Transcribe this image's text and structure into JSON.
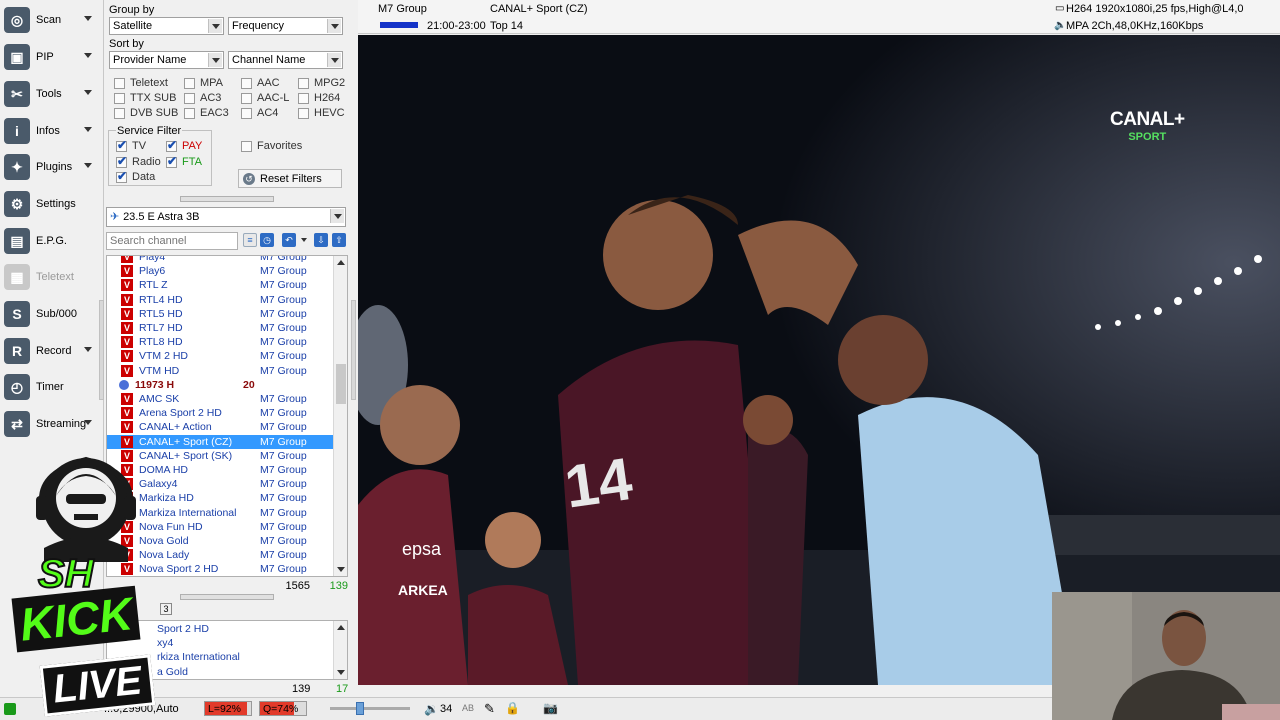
{
  "toolbar": {
    "items": [
      {
        "label": "Scan",
        "icon": "satellite-dish-icon",
        "arrow": true
      },
      {
        "label": "PIP",
        "icon": "pip-icon",
        "arrow": true
      },
      {
        "label": "Tools",
        "icon": "tools-icon",
        "arrow": true
      },
      {
        "label": "Infos",
        "icon": "info-icon",
        "arrow": true
      },
      {
        "label": "Plugins",
        "icon": "plugins-icon",
        "arrow": true
      },
      {
        "label": "Settings",
        "icon": "settings-gear-icon",
        "arrow": false
      },
      {
        "label": "E.P.G.",
        "icon": "epg-icon",
        "arrow": false
      },
      {
        "label": "Teletext",
        "icon": "teletext-icon",
        "arrow": false,
        "disabled": true
      },
      {
        "label": "Sub/000",
        "icon": "subtitle-icon",
        "arrow": false
      },
      {
        "label": "Record",
        "icon": "record-icon",
        "arrow": true
      },
      {
        "label": "Timer",
        "icon": "timer-icon",
        "arrow": false
      },
      {
        "label": "Streaming",
        "icon": "streaming-icon",
        "arrow": true
      }
    ]
  },
  "filters": {
    "group_by_label": "Group by",
    "group_by_1": "Satellite",
    "group_by_2": "Frequency",
    "sort_by_label": "Sort by",
    "sort_by_1": "Provider Name",
    "sort_by_2": "Channel Name",
    "checks": [
      [
        "Teletext",
        "MPA",
        "AAC",
        "MPG2"
      ],
      [
        "TTX SUB",
        "AC3",
        "AAC-L",
        "H264"
      ],
      [
        "DVB SUB",
        "EAC3",
        "AC4",
        "HEVC"
      ]
    ],
    "service_filter_label": "Service Filter",
    "service": {
      "tv": "TV",
      "pay": "PAY",
      "radio": "Radio",
      "fta": "FTA",
      "data": "Data"
    },
    "favorites_label": "Favorites",
    "reset_label": "Reset Filters"
  },
  "satellite": "23.5 E Astra 3B",
  "search": {
    "placeholder": "Search channel"
  },
  "channels": [
    {
      "name": "Play4",
      "provider": "M7 Group"
    },
    {
      "name": "Play6",
      "provider": "M7 Group"
    },
    {
      "name": "RTL Z",
      "provider": "M7 Group"
    },
    {
      "name": "RTL4 HD",
      "provider": "M7 Group"
    },
    {
      "name": "RTL5 HD",
      "provider": "M7 Group"
    },
    {
      "name": "RTL7 HD",
      "provider": "M7 Group"
    },
    {
      "name": "RTL8 HD",
      "provider": "M7 Group"
    },
    {
      "name": "VTM 2 HD",
      "provider": "M7 Group"
    },
    {
      "name": "VTM HD",
      "provider": "M7 Group"
    },
    {
      "group": true,
      "name": "11973 H",
      "count": "20"
    },
    {
      "name": "AMC SK",
      "provider": "M7 Group"
    },
    {
      "name": "Arena Sport 2 HD",
      "provider": "M7 Group"
    },
    {
      "name": "CANAL+ Action",
      "provider": "M7 Group"
    },
    {
      "name": "CANAL+ Sport (CZ)",
      "provider": "M7 Group",
      "selected": true
    },
    {
      "name": "CANAL+ Sport (SK)",
      "provider": "M7 Group"
    },
    {
      "name": "DOMA HD",
      "provider": "M7 Group"
    },
    {
      "name": "Galaxy4",
      "provider": "M7 Group"
    },
    {
      "name": "Markiza HD",
      "provider": "M7 Group"
    },
    {
      "name": "Markiza International",
      "provider": "M7 Group"
    },
    {
      "name": "Nova Fun HD",
      "provider": "M7 Group"
    },
    {
      "name": "Nova Gold",
      "provider": "M7 Group"
    },
    {
      "name": "Nova Lady",
      "provider": "M7 Group"
    },
    {
      "name": "Nova Sport 2 HD",
      "provider": "M7 Group"
    }
  ],
  "counts": {
    "total": "1565",
    "filtered": "139"
  },
  "sublist": {
    "items": [
      "Sport 2 HD",
      "xy4",
      "rkiza International",
      "a Gold"
    ],
    "count_a": "139",
    "count_b": "17"
  },
  "statusbar": {
    "signal_text": "...0,29900,Auto",
    "level": "L=92%",
    "quality": "Q=74%",
    "volume": "34",
    "level_fraction": 0.92,
    "quality_fraction": 0.74
  },
  "infobar": {
    "provider": "M7 Group",
    "channel": "CANAL+ Sport (CZ)",
    "time": "21:00-23:00",
    "program": "Top 14",
    "video_info": "H264 1920x1080i,25 fps,High@L4,0",
    "audio_info": "MPA 2Ch,48,0KHz,160Kbps"
  },
  "video": {
    "channel_logo": "CANAL+",
    "channel_logo_sub": "SPORT",
    "jersey_number": "14",
    "sponsor_1": "epsa",
    "sponsor_2": "ARKEA"
  },
  "overlay_logo": {
    "top": "SH",
    "middle": "KICK",
    "bottom": "LIVE"
  },
  "colors": {
    "accent": "#3399ff",
    "channel_text": "#1a3fa8",
    "red": "#c00000",
    "kick_green": "#53fc18"
  }
}
